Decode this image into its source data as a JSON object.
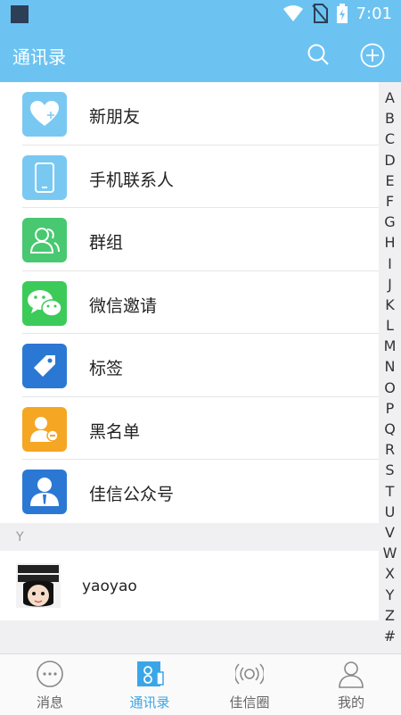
{
  "status_bar": {
    "time": "7:01"
  },
  "app_bar": {
    "title": "通讯录",
    "search_icon": "search-icon",
    "add_icon": "plus-circle-icon"
  },
  "menu": [
    {
      "label": "新朋友",
      "icon": "heart-plus-icon",
      "color": "#79c8f2"
    },
    {
      "label": "手机联系人",
      "icon": "phone-icon",
      "color": "#79c8f2"
    },
    {
      "label": "群组",
      "icon": "group-icon",
      "color": "#48c870"
    },
    {
      "label": "微信邀请",
      "icon": "wechat-icon",
      "color": "#3ccb59"
    },
    {
      "label": "标签",
      "icon": "tag-icon",
      "color": "#2a78d4"
    },
    {
      "label": "黑名单",
      "icon": "blacklist-icon",
      "color": "#f5a623"
    },
    {
      "label": "佳信公众号",
      "icon": "official-account-icon",
      "color": "#2a78d4"
    }
  ],
  "section": {
    "letter": "Y"
  },
  "contacts": [
    {
      "name": "yaoyao"
    }
  ],
  "index_letters": [
    "A",
    "B",
    "C",
    "D",
    "E",
    "F",
    "G",
    "H",
    "I",
    "J",
    "K",
    "L",
    "M",
    "N",
    "O",
    "P",
    "Q",
    "R",
    "S",
    "T",
    "U",
    "V",
    "W",
    "X",
    "Y",
    "Z",
    "#"
  ],
  "tabs": [
    {
      "label": "消息",
      "icon": "chat-bubble-icon",
      "active": false
    },
    {
      "label": "通讯录",
      "icon": "contacts-icon",
      "active": true
    },
    {
      "label": "佳信圈",
      "icon": "broadcast-icon",
      "active": false
    },
    {
      "label": "我的",
      "icon": "person-icon",
      "active": false
    }
  ],
  "colors": {
    "primary": "#6cc3f1",
    "active_tab": "#3aa6e8"
  }
}
